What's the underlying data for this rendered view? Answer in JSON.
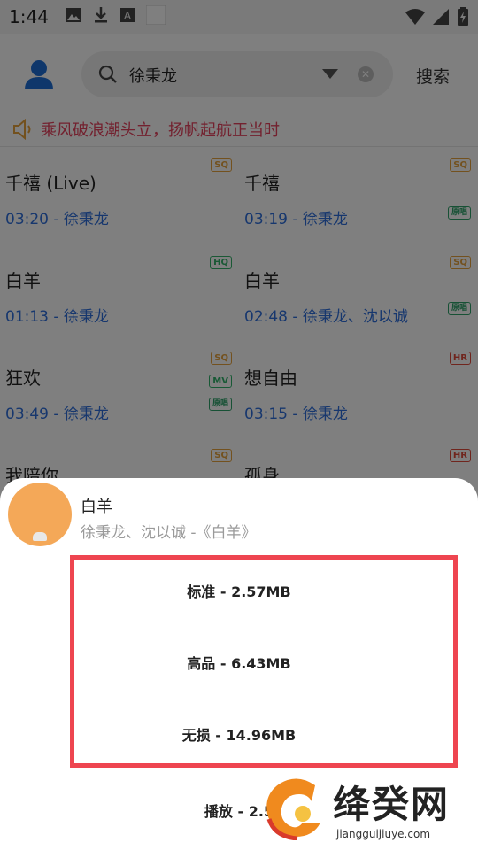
{
  "status_bar": {
    "time": "1:44"
  },
  "search": {
    "query": "徐秉龙",
    "button_label": "搜索"
  },
  "notice": {
    "text": "乘风破浪潮头立，扬帆起航正当时"
  },
  "songs": [
    {
      "title": "千禧 (Live)",
      "meta": "03:20 - 徐秉龙",
      "badges": [
        "SQ"
      ]
    },
    {
      "title": "千禧",
      "meta": "03:19 - 徐秉龙",
      "badges": [
        "SQ",
        "原唱"
      ]
    },
    {
      "title": "白羊",
      "meta": "01:13 - 徐秉龙",
      "badges": [
        "HQ"
      ]
    },
    {
      "title": "白羊",
      "meta": "02:48 - 徐秉龙、沈以诚",
      "badges": [
        "SQ",
        "原唱"
      ]
    },
    {
      "title": "狂欢",
      "meta": "03:49 - 徐秉龙",
      "badges": [
        "SQ",
        "MV",
        "原唱"
      ]
    },
    {
      "title": "想自由",
      "meta": "03:15 - 徐秉龙",
      "badges": [
        "HR"
      ]
    },
    {
      "title": "我陪你",
      "meta": "",
      "badges": [
        "SQ"
      ]
    },
    {
      "title": "孤身",
      "meta": "",
      "badges": [
        "HR"
      ]
    }
  ],
  "sheet": {
    "title": "白羊",
    "subtitle": "徐秉龙、沈以诚 -《白羊》",
    "options": [
      {
        "label": "标准 - 2.57MB"
      },
      {
        "label": "高品 - 6.43MB"
      },
      {
        "label": "无损 - 14.96MB"
      },
      {
        "label": "播放 - 2.5"
      }
    ]
  },
  "watermark": {
    "name": "绛癸网",
    "url": "jiangguijiuye.com"
  },
  "colors": {
    "accent_blue": "#2e6fdc",
    "notice_red": "#e6435f",
    "highlight_red": "#ee4550",
    "cover_orange": "#f4a858"
  }
}
